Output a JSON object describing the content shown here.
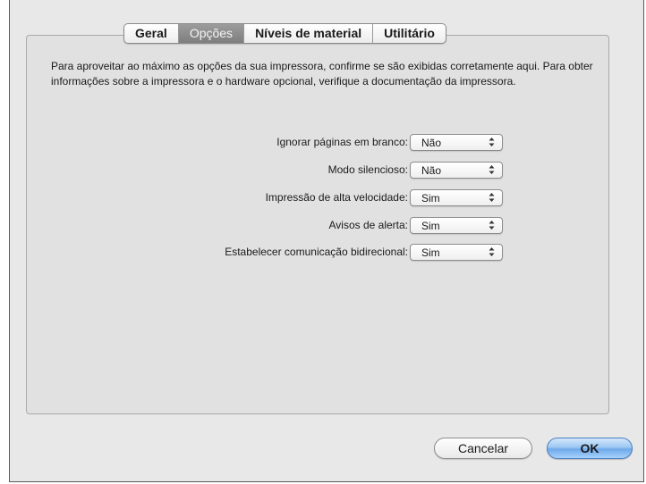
{
  "tabs": [
    {
      "label": "Geral",
      "selected": false
    },
    {
      "label": "Opções",
      "selected": true
    },
    {
      "label": "Níveis de material",
      "selected": false
    },
    {
      "label": "Utilitário",
      "selected": false
    }
  ],
  "description": "Para aproveitar ao máximo as opções da sua impressora, confirme se são exibidas corretamente aqui. Para obter informações sobre a impressora e o hardware opcional, verifique a documentação da impressora.",
  "options": [
    {
      "label": "Ignorar páginas em branco:",
      "value": "Não"
    },
    {
      "label": "Modo silencioso:",
      "value": "Não"
    },
    {
      "label": "Impressão de alta velocidade:",
      "value": "Sim"
    },
    {
      "label": "Avisos de alerta:",
      "value": "Sim"
    },
    {
      "label": "Estabelecer comunicação bidirecional:",
      "value": "Sim"
    }
  ],
  "buttons": {
    "cancel_label": "Cancelar",
    "ok_label": "OK"
  },
  "colors": {
    "selected_tab": "#8e8e8e",
    "default_button": "#7fb5ee"
  },
  "icons": {
    "popup_indicator": "up-down-arrows-icon"
  }
}
